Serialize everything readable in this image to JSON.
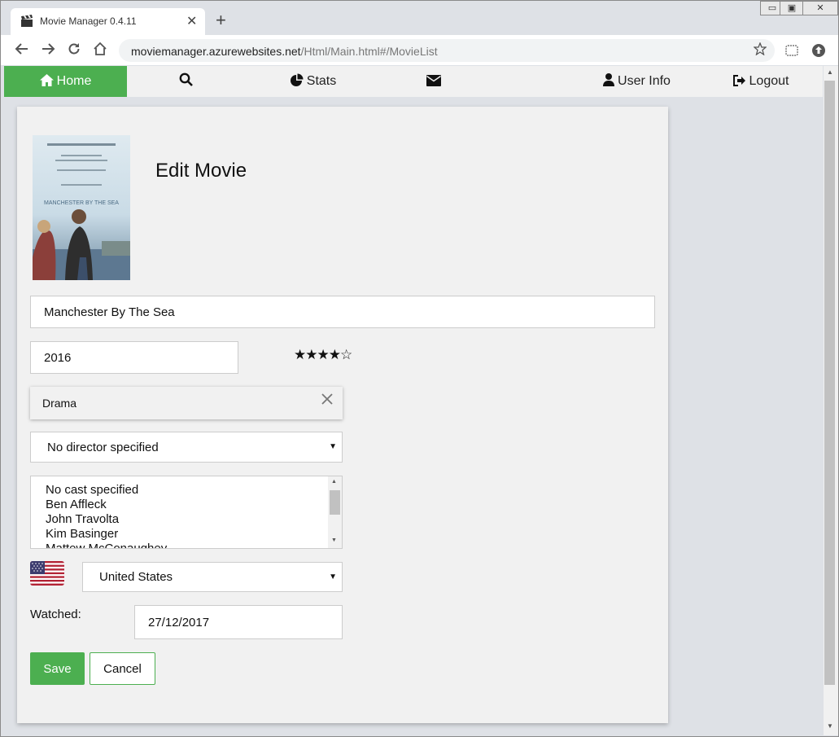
{
  "browser": {
    "tab_title": "Movie Manager 0.4.11",
    "tab_close": "✕",
    "new_tab": "+",
    "url_host": "moviemanager.azurewebsites.net",
    "url_path": "/Html/Main.html#/MovieList",
    "window_controls": [
      "▭",
      "▣",
      "✕"
    ]
  },
  "navbar": {
    "home": "Home",
    "stats": "Stats",
    "user_info": "User Info",
    "logout": "Logout"
  },
  "page": {
    "heading": "Edit Movie",
    "poster_alt": "Manchester By The Sea poster",
    "poster_title": "MANCHESTER BY THE SEA"
  },
  "form": {
    "title": "Manchester By The Sea",
    "year": "2016",
    "rating": 4,
    "rating_max": 5,
    "genre": "Drama",
    "director": "No director specified",
    "cast_options": [
      "No cast specified",
      "Ben Affleck",
      "John Travolta",
      "Kim Basinger",
      "Mattew McConaughey"
    ],
    "country": "United States",
    "watched_label": "Watched:",
    "watched_date": "27/12/2017",
    "save_label": "Save",
    "cancel_label": "Cancel"
  },
  "colors": {
    "accent": "#4caf50",
    "nav_bg": "#f1f1f1",
    "card_bg": "#f1f1f1"
  },
  "icons": [
    "clapperboard-icon",
    "back-icon",
    "forward-icon",
    "reload-icon",
    "home-icon",
    "star-icon",
    "search-icon",
    "pie-chart-icon",
    "envelope-icon",
    "user-icon",
    "logout-icon",
    "close-icon",
    "us-flag-icon"
  ]
}
